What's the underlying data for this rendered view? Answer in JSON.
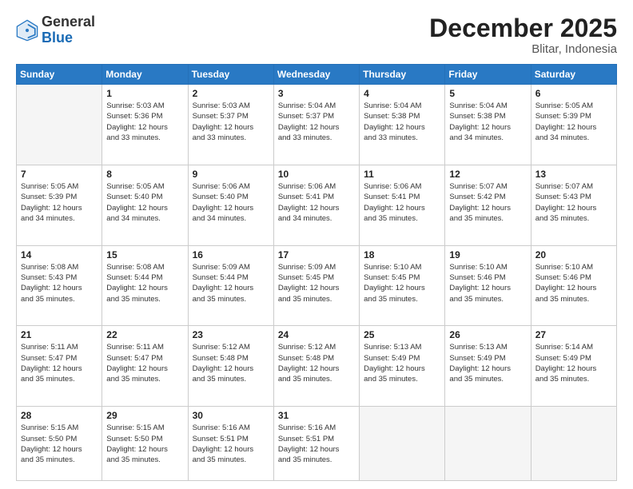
{
  "header": {
    "logo": {
      "general": "General",
      "blue": "Blue"
    },
    "title": "December 2025",
    "location": "Blitar, Indonesia"
  },
  "weekdays": [
    "Sunday",
    "Monday",
    "Tuesday",
    "Wednesday",
    "Thursday",
    "Friday",
    "Saturday"
  ],
  "weeks": [
    [
      {
        "day": "",
        "info": ""
      },
      {
        "day": "1",
        "info": "Sunrise: 5:03 AM\nSunset: 5:36 PM\nDaylight: 12 hours\nand 33 minutes."
      },
      {
        "day": "2",
        "info": "Sunrise: 5:03 AM\nSunset: 5:37 PM\nDaylight: 12 hours\nand 33 minutes."
      },
      {
        "day": "3",
        "info": "Sunrise: 5:04 AM\nSunset: 5:37 PM\nDaylight: 12 hours\nand 33 minutes."
      },
      {
        "day": "4",
        "info": "Sunrise: 5:04 AM\nSunset: 5:38 PM\nDaylight: 12 hours\nand 33 minutes."
      },
      {
        "day": "5",
        "info": "Sunrise: 5:04 AM\nSunset: 5:38 PM\nDaylight: 12 hours\nand 34 minutes."
      },
      {
        "day": "6",
        "info": "Sunrise: 5:05 AM\nSunset: 5:39 PM\nDaylight: 12 hours\nand 34 minutes."
      }
    ],
    [
      {
        "day": "7",
        "info": "Sunrise: 5:05 AM\nSunset: 5:39 PM\nDaylight: 12 hours\nand 34 minutes."
      },
      {
        "day": "8",
        "info": "Sunrise: 5:05 AM\nSunset: 5:40 PM\nDaylight: 12 hours\nand 34 minutes."
      },
      {
        "day": "9",
        "info": "Sunrise: 5:06 AM\nSunset: 5:40 PM\nDaylight: 12 hours\nand 34 minutes."
      },
      {
        "day": "10",
        "info": "Sunrise: 5:06 AM\nSunset: 5:41 PM\nDaylight: 12 hours\nand 34 minutes."
      },
      {
        "day": "11",
        "info": "Sunrise: 5:06 AM\nSunset: 5:41 PM\nDaylight: 12 hours\nand 35 minutes."
      },
      {
        "day": "12",
        "info": "Sunrise: 5:07 AM\nSunset: 5:42 PM\nDaylight: 12 hours\nand 35 minutes."
      },
      {
        "day": "13",
        "info": "Sunrise: 5:07 AM\nSunset: 5:43 PM\nDaylight: 12 hours\nand 35 minutes."
      }
    ],
    [
      {
        "day": "14",
        "info": "Sunrise: 5:08 AM\nSunset: 5:43 PM\nDaylight: 12 hours\nand 35 minutes."
      },
      {
        "day": "15",
        "info": "Sunrise: 5:08 AM\nSunset: 5:44 PM\nDaylight: 12 hours\nand 35 minutes."
      },
      {
        "day": "16",
        "info": "Sunrise: 5:09 AM\nSunset: 5:44 PM\nDaylight: 12 hours\nand 35 minutes."
      },
      {
        "day": "17",
        "info": "Sunrise: 5:09 AM\nSunset: 5:45 PM\nDaylight: 12 hours\nand 35 minutes."
      },
      {
        "day": "18",
        "info": "Sunrise: 5:10 AM\nSunset: 5:45 PM\nDaylight: 12 hours\nand 35 minutes."
      },
      {
        "day": "19",
        "info": "Sunrise: 5:10 AM\nSunset: 5:46 PM\nDaylight: 12 hours\nand 35 minutes."
      },
      {
        "day": "20",
        "info": "Sunrise: 5:10 AM\nSunset: 5:46 PM\nDaylight: 12 hours\nand 35 minutes."
      }
    ],
    [
      {
        "day": "21",
        "info": "Sunrise: 5:11 AM\nSunset: 5:47 PM\nDaylight: 12 hours\nand 35 minutes."
      },
      {
        "day": "22",
        "info": "Sunrise: 5:11 AM\nSunset: 5:47 PM\nDaylight: 12 hours\nand 35 minutes."
      },
      {
        "day": "23",
        "info": "Sunrise: 5:12 AM\nSunset: 5:48 PM\nDaylight: 12 hours\nand 35 minutes."
      },
      {
        "day": "24",
        "info": "Sunrise: 5:12 AM\nSunset: 5:48 PM\nDaylight: 12 hours\nand 35 minutes."
      },
      {
        "day": "25",
        "info": "Sunrise: 5:13 AM\nSunset: 5:49 PM\nDaylight: 12 hours\nand 35 minutes."
      },
      {
        "day": "26",
        "info": "Sunrise: 5:13 AM\nSunset: 5:49 PM\nDaylight: 12 hours\nand 35 minutes."
      },
      {
        "day": "27",
        "info": "Sunrise: 5:14 AM\nSunset: 5:49 PM\nDaylight: 12 hours\nand 35 minutes."
      }
    ],
    [
      {
        "day": "28",
        "info": "Sunrise: 5:15 AM\nSunset: 5:50 PM\nDaylight: 12 hours\nand 35 minutes."
      },
      {
        "day": "29",
        "info": "Sunrise: 5:15 AM\nSunset: 5:50 PM\nDaylight: 12 hours\nand 35 minutes."
      },
      {
        "day": "30",
        "info": "Sunrise: 5:16 AM\nSunset: 5:51 PM\nDaylight: 12 hours\nand 35 minutes."
      },
      {
        "day": "31",
        "info": "Sunrise: 5:16 AM\nSunset: 5:51 PM\nDaylight: 12 hours\nand 35 minutes."
      },
      {
        "day": "",
        "info": ""
      },
      {
        "day": "",
        "info": ""
      },
      {
        "day": "",
        "info": ""
      }
    ]
  ]
}
